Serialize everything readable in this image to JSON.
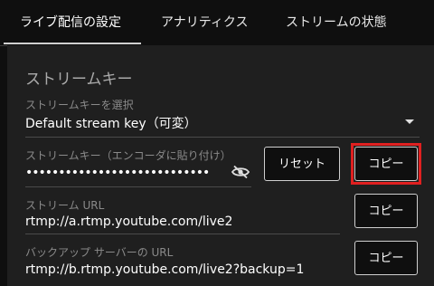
{
  "tabs": [
    {
      "label": "ライブ配信の設定"
    },
    {
      "label": "アナリティクス"
    },
    {
      "label": "ストリームの状態"
    }
  ],
  "section_title": "ストリームキー",
  "stream_key_select": {
    "label": "ストリームキーを選択",
    "value": "Default stream key（可変）",
    "icon": "dropdown-arrow-icon"
  },
  "stream_key": {
    "label": "ストリームキー（エンコーダに貼り付け）",
    "value": "••••••••••••••••••••••••••••",
    "visibility_icon": "eye-off-icon",
    "reset_label": "リセット",
    "copy_label": "コピー"
  },
  "stream_url": {
    "label": "ストリーム URL",
    "value": "rtmp://a.rtmp.youtube.com/live2",
    "copy_label": "コピー"
  },
  "backup_url": {
    "label": "バックアップ サーバーの URL",
    "value": "rtmp://b.rtmp.youtube.com/live2?backup=1",
    "copy_label": "コピー"
  },
  "colors": {
    "highlight": "#e02020",
    "background": "#0f0f0f",
    "panel": "#1f1f1f"
  }
}
